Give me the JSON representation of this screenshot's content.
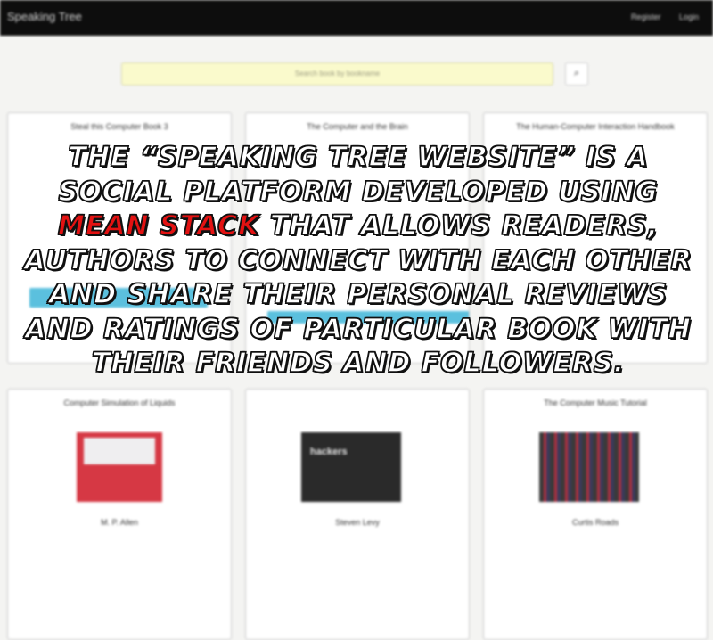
{
  "header": {
    "brand": "Speaking Tree",
    "links": [
      "Register",
      "Login"
    ]
  },
  "search": {
    "placeholder": "Search book by bookname",
    "button_icon": "search-icon"
  },
  "books": [
    {
      "title": "Steal this Computer Book 3",
      "author": ""
    },
    {
      "title": "The Computer and the Brain",
      "author": ""
    },
    {
      "title": "The Human-Computer Interaction Handbook",
      "author": ""
    },
    {
      "title": "Computer Simulation of Liquids",
      "author": "M. P. Allen"
    },
    {
      "title": "",
      "author": "Steven Levy",
      "cover_text": "hackers"
    },
    {
      "title": "The Computer Music Tutorial",
      "author": "Curtis Roads"
    }
  ],
  "overlay": {
    "part1": "The “Speaking Tree Website” is a social platform developed using",
    "highlight": "MEAN Stack",
    "part2": "that allows readers, authors to connect with each other and share their personal reviews and ratings of particular book with their friends and followers."
  },
  "colors": {
    "navbar": "#0d0d0d",
    "search_bg": "#fafacc",
    "accent_red": "#e31212",
    "button_blue": "#5bc0de"
  }
}
